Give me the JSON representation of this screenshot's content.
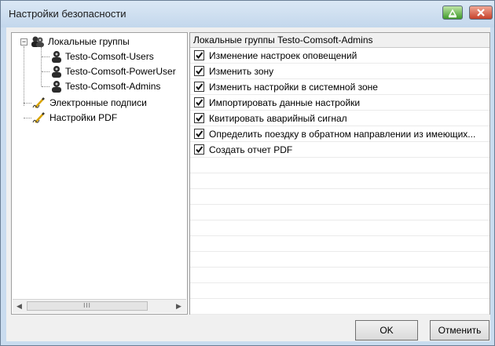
{
  "window": {
    "title": "Настройки безопасности"
  },
  "tree": {
    "nodes": [
      {
        "label": "Локальные группы",
        "expander": "−"
      },
      {
        "label": "Testo-Comsoft-Users"
      },
      {
        "label": "Testo-Comsoft-PowerUser"
      },
      {
        "label": "Testo-Comsoft-Admins"
      },
      {
        "label": "Электронные подписи"
      },
      {
        "label": "Настройки PDF"
      }
    ],
    "scroll": {
      "thumb_label": "III"
    }
  },
  "permissions": {
    "header": "Локальные группы Testo-Comsoft-Admins",
    "items": [
      {
        "label": "Изменение настроек оповещений",
        "checked": true
      },
      {
        "label": "Изменить зону",
        "checked": true
      },
      {
        "label": "Изменить настройки в системной зоне",
        "checked": true
      },
      {
        "label": "Импортировать данные настройки",
        "checked": true
      },
      {
        "label": "Квитировать аварийный сигнал",
        "checked": true
      },
      {
        "label": "Определить поездку в обратном направлении из имеющих...",
        "checked": true
      },
      {
        "label": "Создать отчет PDF",
        "checked": true
      }
    ]
  },
  "buttons": {
    "ok": "OK",
    "cancel": "Отменить"
  }
}
